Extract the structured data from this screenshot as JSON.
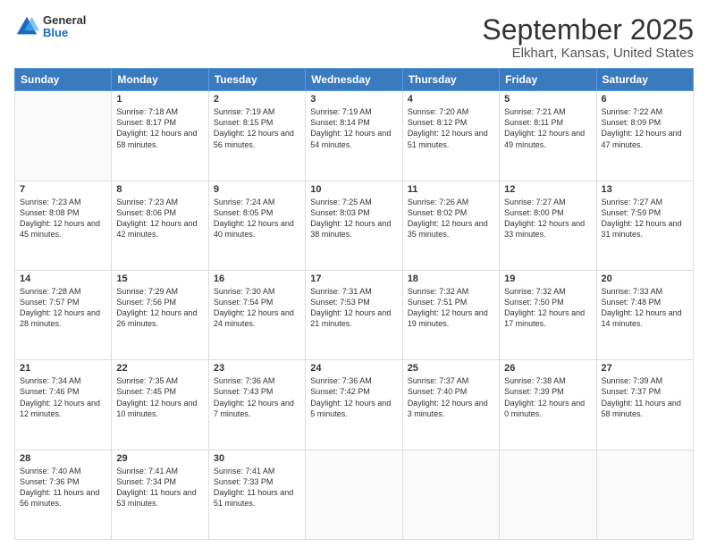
{
  "logo": {
    "general": "General",
    "blue": "Blue"
  },
  "title": "September 2025",
  "subtitle": "Elkhart, Kansas, United States",
  "days_of_week": [
    "Sunday",
    "Monday",
    "Tuesday",
    "Wednesday",
    "Thursday",
    "Friday",
    "Saturday"
  ],
  "weeks": [
    [
      {
        "day": "",
        "empty": true
      },
      {
        "day": "1",
        "sunrise": "Sunrise: 7:18 AM",
        "sunset": "Sunset: 8:17 PM",
        "daylight": "Daylight: 12 hours and 58 minutes."
      },
      {
        "day": "2",
        "sunrise": "Sunrise: 7:19 AM",
        "sunset": "Sunset: 8:15 PM",
        "daylight": "Daylight: 12 hours and 56 minutes."
      },
      {
        "day": "3",
        "sunrise": "Sunrise: 7:19 AM",
        "sunset": "Sunset: 8:14 PM",
        "daylight": "Daylight: 12 hours and 54 minutes."
      },
      {
        "day": "4",
        "sunrise": "Sunrise: 7:20 AM",
        "sunset": "Sunset: 8:12 PM",
        "daylight": "Daylight: 12 hours and 51 minutes."
      },
      {
        "day": "5",
        "sunrise": "Sunrise: 7:21 AM",
        "sunset": "Sunset: 8:11 PM",
        "daylight": "Daylight: 12 hours and 49 minutes."
      },
      {
        "day": "6",
        "sunrise": "Sunrise: 7:22 AM",
        "sunset": "Sunset: 8:09 PM",
        "daylight": "Daylight: 12 hours and 47 minutes."
      }
    ],
    [
      {
        "day": "7",
        "sunrise": "Sunrise: 7:23 AM",
        "sunset": "Sunset: 8:08 PM",
        "daylight": "Daylight: 12 hours and 45 minutes."
      },
      {
        "day": "8",
        "sunrise": "Sunrise: 7:23 AM",
        "sunset": "Sunset: 8:06 PM",
        "daylight": "Daylight: 12 hours and 42 minutes."
      },
      {
        "day": "9",
        "sunrise": "Sunrise: 7:24 AM",
        "sunset": "Sunset: 8:05 PM",
        "daylight": "Daylight: 12 hours and 40 minutes."
      },
      {
        "day": "10",
        "sunrise": "Sunrise: 7:25 AM",
        "sunset": "Sunset: 8:03 PM",
        "daylight": "Daylight: 12 hours and 38 minutes."
      },
      {
        "day": "11",
        "sunrise": "Sunrise: 7:26 AM",
        "sunset": "Sunset: 8:02 PM",
        "daylight": "Daylight: 12 hours and 35 minutes."
      },
      {
        "day": "12",
        "sunrise": "Sunrise: 7:27 AM",
        "sunset": "Sunset: 8:00 PM",
        "daylight": "Daylight: 12 hours and 33 minutes."
      },
      {
        "day": "13",
        "sunrise": "Sunrise: 7:27 AM",
        "sunset": "Sunset: 7:59 PM",
        "daylight": "Daylight: 12 hours and 31 minutes."
      }
    ],
    [
      {
        "day": "14",
        "sunrise": "Sunrise: 7:28 AM",
        "sunset": "Sunset: 7:57 PM",
        "daylight": "Daylight: 12 hours and 28 minutes."
      },
      {
        "day": "15",
        "sunrise": "Sunrise: 7:29 AM",
        "sunset": "Sunset: 7:56 PM",
        "daylight": "Daylight: 12 hours and 26 minutes."
      },
      {
        "day": "16",
        "sunrise": "Sunrise: 7:30 AM",
        "sunset": "Sunset: 7:54 PM",
        "daylight": "Daylight: 12 hours and 24 minutes."
      },
      {
        "day": "17",
        "sunrise": "Sunrise: 7:31 AM",
        "sunset": "Sunset: 7:53 PM",
        "daylight": "Daylight: 12 hours and 21 minutes."
      },
      {
        "day": "18",
        "sunrise": "Sunrise: 7:32 AM",
        "sunset": "Sunset: 7:51 PM",
        "daylight": "Daylight: 12 hours and 19 minutes."
      },
      {
        "day": "19",
        "sunrise": "Sunrise: 7:32 AM",
        "sunset": "Sunset: 7:50 PM",
        "daylight": "Daylight: 12 hours and 17 minutes."
      },
      {
        "day": "20",
        "sunrise": "Sunrise: 7:33 AM",
        "sunset": "Sunset: 7:48 PM",
        "daylight": "Daylight: 12 hours and 14 minutes."
      }
    ],
    [
      {
        "day": "21",
        "sunrise": "Sunrise: 7:34 AM",
        "sunset": "Sunset: 7:46 PM",
        "daylight": "Daylight: 12 hours and 12 minutes."
      },
      {
        "day": "22",
        "sunrise": "Sunrise: 7:35 AM",
        "sunset": "Sunset: 7:45 PM",
        "daylight": "Daylight: 12 hours and 10 minutes."
      },
      {
        "day": "23",
        "sunrise": "Sunrise: 7:36 AM",
        "sunset": "Sunset: 7:43 PM",
        "daylight": "Daylight: 12 hours and 7 minutes."
      },
      {
        "day": "24",
        "sunrise": "Sunrise: 7:36 AM",
        "sunset": "Sunset: 7:42 PM",
        "daylight": "Daylight: 12 hours and 5 minutes."
      },
      {
        "day": "25",
        "sunrise": "Sunrise: 7:37 AM",
        "sunset": "Sunset: 7:40 PM",
        "daylight": "Daylight: 12 hours and 3 minutes."
      },
      {
        "day": "26",
        "sunrise": "Sunrise: 7:38 AM",
        "sunset": "Sunset: 7:39 PM",
        "daylight": "Daylight: 12 hours and 0 minutes."
      },
      {
        "day": "27",
        "sunrise": "Sunrise: 7:39 AM",
        "sunset": "Sunset: 7:37 PM",
        "daylight": "Daylight: 11 hours and 58 minutes."
      }
    ],
    [
      {
        "day": "28",
        "sunrise": "Sunrise: 7:40 AM",
        "sunset": "Sunset: 7:36 PM",
        "daylight": "Daylight: 11 hours and 56 minutes."
      },
      {
        "day": "29",
        "sunrise": "Sunrise: 7:41 AM",
        "sunset": "Sunset: 7:34 PM",
        "daylight": "Daylight: 11 hours and 53 minutes."
      },
      {
        "day": "30",
        "sunrise": "Sunrise: 7:41 AM",
        "sunset": "Sunset: 7:33 PM",
        "daylight": "Daylight: 11 hours and 51 minutes."
      },
      {
        "day": "",
        "empty": true
      },
      {
        "day": "",
        "empty": true
      },
      {
        "day": "",
        "empty": true
      },
      {
        "day": "",
        "empty": true
      }
    ]
  ]
}
